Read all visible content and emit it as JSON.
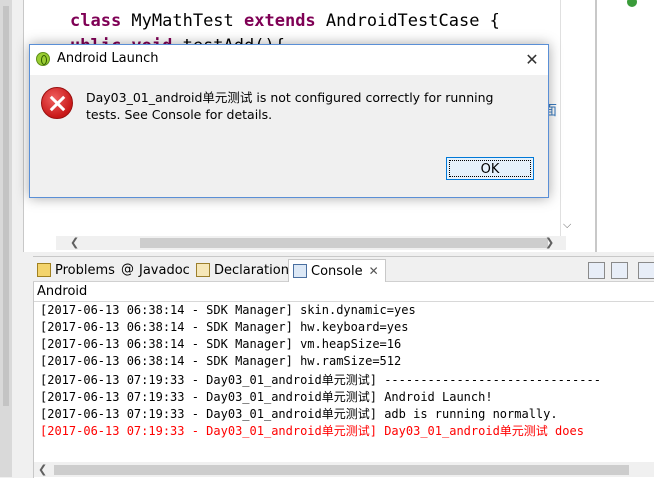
{
  "editor": {
    "class_kw": "class",
    "class_name": " MyMathTest ",
    "extends_kw": "extends",
    "base_class": " AndroidTestCase {",
    "method_kw": "ublic void",
    "method_name": " testAdd(){",
    "hint_char": "面"
  },
  "dialog": {
    "title": "Android Launch",
    "close_glyph": "✕",
    "message": "Day03_01_android单元测试 is not configured correctly for running tests. See Console for details.",
    "ok_label": "OK"
  },
  "console": {
    "tabs": [
      {
        "label": "Problems",
        "icon": "problems-icon"
      },
      {
        "label": "Javadoc",
        "icon": "javadoc-icon",
        "glyph": "@"
      },
      {
        "label": "Declaration",
        "icon": "declaration-icon"
      },
      {
        "label": "Console",
        "icon": "console-icon",
        "close": "✕"
      }
    ],
    "title": "Android",
    "lines": [
      {
        "text": "[2017-06-13 06:38:14 - SDK Manager] skin.dynamic=yes",
        "error": false
      },
      {
        "text": "[2017-06-13 06:38:14 - SDK Manager] hw.keyboard=yes",
        "error": false
      },
      {
        "text": "[2017-06-13 06:38:14 - SDK Manager] vm.heapSize=16",
        "error": false
      },
      {
        "text": "[2017-06-13 06:38:14 - SDK Manager] hw.ramSize=512",
        "error": false
      },
      {
        "text": "[2017-06-13 07:19:33 - Day03_01_android单元测试] ------------------------------",
        "error": false
      },
      {
        "text": "[2017-06-13 07:19:33 - Day03_01_android单元测试] Android Launch!",
        "error": false
      },
      {
        "text": "[2017-06-13 07:19:33 - Day03_01_android单元测试] adb is running normally.",
        "error": false
      },
      {
        "text": "[2017-06-13 07:19:33 - Day03_01_android单元测试] Day03_01_android单元测试 does",
        "error": true
      }
    ]
  },
  "colors": {
    "keyword": "#7f0055",
    "error_text": "#ff0000",
    "dialog_border": "#5a8fd6",
    "ok_border": "#0078d7"
  }
}
